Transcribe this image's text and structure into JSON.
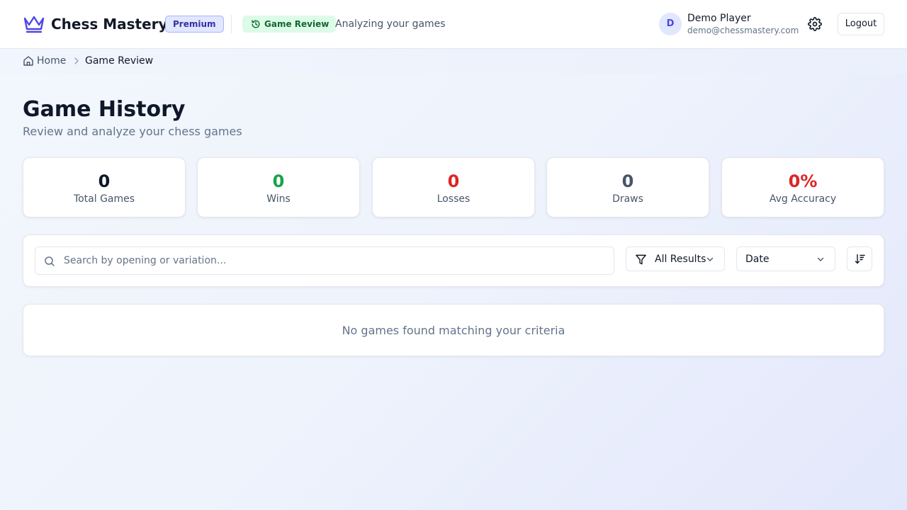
{
  "header": {
    "brand": "Chess Mastery",
    "badge": "Premium",
    "section_pill": "Game Review",
    "subtitle": "Analyzing your games",
    "user": {
      "avatar_letter": "D",
      "name": "Demo Player",
      "email": "demo@chessmastery.com"
    },
    "logout_label": "Logout",
    "icons": {
      "logo": "crown-icon",
      "section": "history-icon",
      "settings": "gear-icon"
    }
  },
  "breadcrumb": {
    "home": "Home",
    "current": "Game Review"
  },
  "page": {
    "title": "Game History",
    "subtitle": "Review and analyze your chess games"
  },
  "stats": [
    {
      "value": "0",
      "label": "Total Games",
      "color": "#0f172a"
    },
    {
      "value": "0",
      "label": "Wins",
      "color": "#16a34a"
    },
    {
      "value": "0",
      "label": "Losses",
      "color": "#dc2626"
    },
    {
      "value": "0",
      "label": "Draws",
      "color": "#475569"
    },
    {
      "value": "0%",
      "label": "Avg Accuracy",
      "color": "#dc2626"
    }
  ],
  "filters": {
    "search_placeholder": "Search by opening or variation...",
    "search_value": "",
    "result_filter": "All Results",
    "sort_by": "Date"
  },
  "empty_state": "No games found matching your criteria",
  "colors": {
    "accent": "#4f46e5",
    "success": "#16a34a",
    "danger": "#dc2626"
  }
}
